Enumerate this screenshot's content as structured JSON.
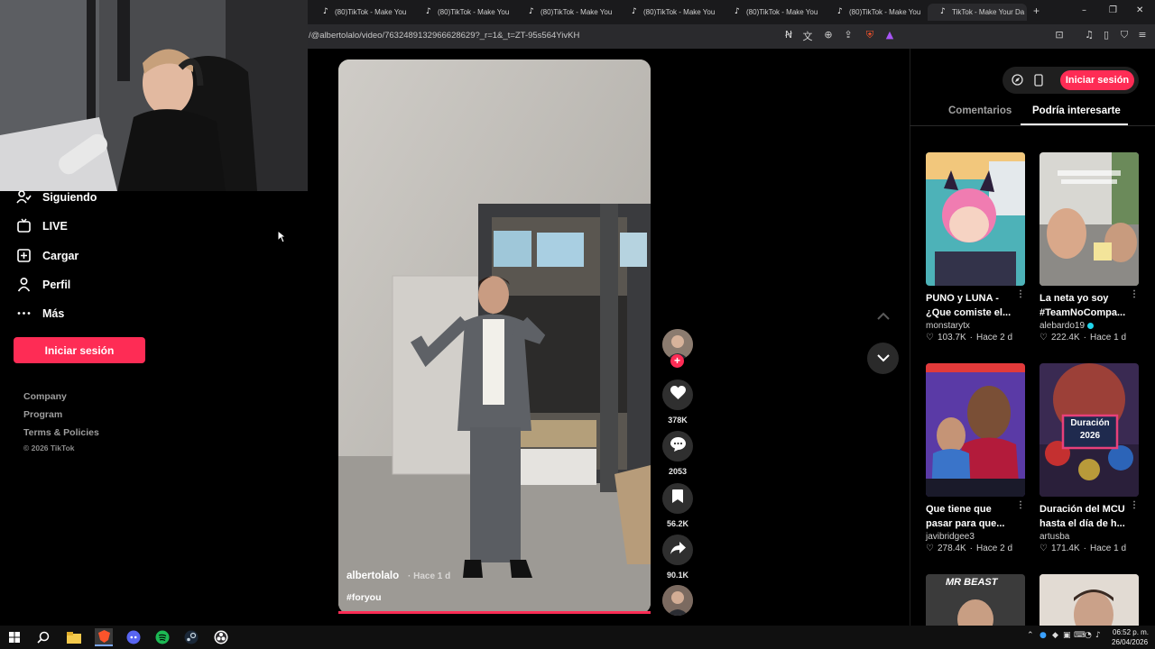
{
  "browser": {
    "tabs": [
      {
        "title": "(80)TikTok - Make You"
      },
      {
        "title": "(80)TikTok - Make You"
      },
      {
        "title": "(80)TikTok - Make You"
      },
      {
        "title": "(80)TikTok - Make You"
      },
      {
        "title": "(80)TikTok - Make You"
      },
      {
        "title": "(80)TikTok - Make You"
      },
      {
        "title": "TikTok - Make Your Da"
      }
    ],
    "new_tab": "+",
    "url": "/@albertolalo/video/7632489132966628629?_r=1&_t=ZT-95s564YivKH"
  },
  "sidebar": {
    "items": [
      {
        "label": "Siguiendo",
        "icon": "following-icon"
      },
      {
        "label": "LIVE",
        "icon": "live-icon"
      },
      {
        "label": "Cargar",
        "icon": "upload-icon"
      },
      {
        "label": "Perfil",
        "icon": "profile-icon"
      },
      {
        "label": "Más",
        "icon": "more-icon"
      }
    ],
    "login_label": "Iniciar sesión",
    "footer": [
      "Company",
      "Program",
      "Terms & Policies"
    ],
    "copyright": "© 2026 TikTok"
  },
  "video": {
    "author": "albertolalo",
    "time": "· Hace 1 d",
    "hashtag": "#foryou",
    "likes": "378K",
    "comments": "2053",
    "saves": "56.2K",
    "shares": "90.1K"
  },
  "right_panel": {
    "login_label": "Iniciar sesión",
    "tabs": [
      "Comentarios",
      "Podría interesarte"
    ],
    "cards": [
      {
        "title": "PUNO y LUNA - ¿Que comiste el...",
        "author": "monstarytx",
        "likes": "103.7K",
        "age": "Hace 2 d",
        "verified": false
      },
      {
        "title": "La neta yo soy #TeamNoCompa...",
        "author": "alebardo19",
        "likes": "222.4K",
        "age": "Hace 1 d",
        "verified": true
      },
      {
        "title": "Que tiene que pasar para que...",
        "author": "javibridgee3",
        "likes": "278.4K",
        "age": "Hace 2 d",
        "verified": false
      },
      {
        "title": "Duración del MCU hasta el día de h...",
        "author": "artusba",
        "likes": "171.4K",
        "age": "Hace 1 d",
        "verified": false
      }
    ],
    "thumb_texts": {
      "duracion": "Duración\n2026",
      "mrbeast": "MR BEAST"
    }
  },
  "taskbar": {
    "time": "06:52 p. m.",
    "date": "26/04/2026"
  },
  "colors": {
    "accent": "#fe2c55",
    "background": "#000000"
  }
}
